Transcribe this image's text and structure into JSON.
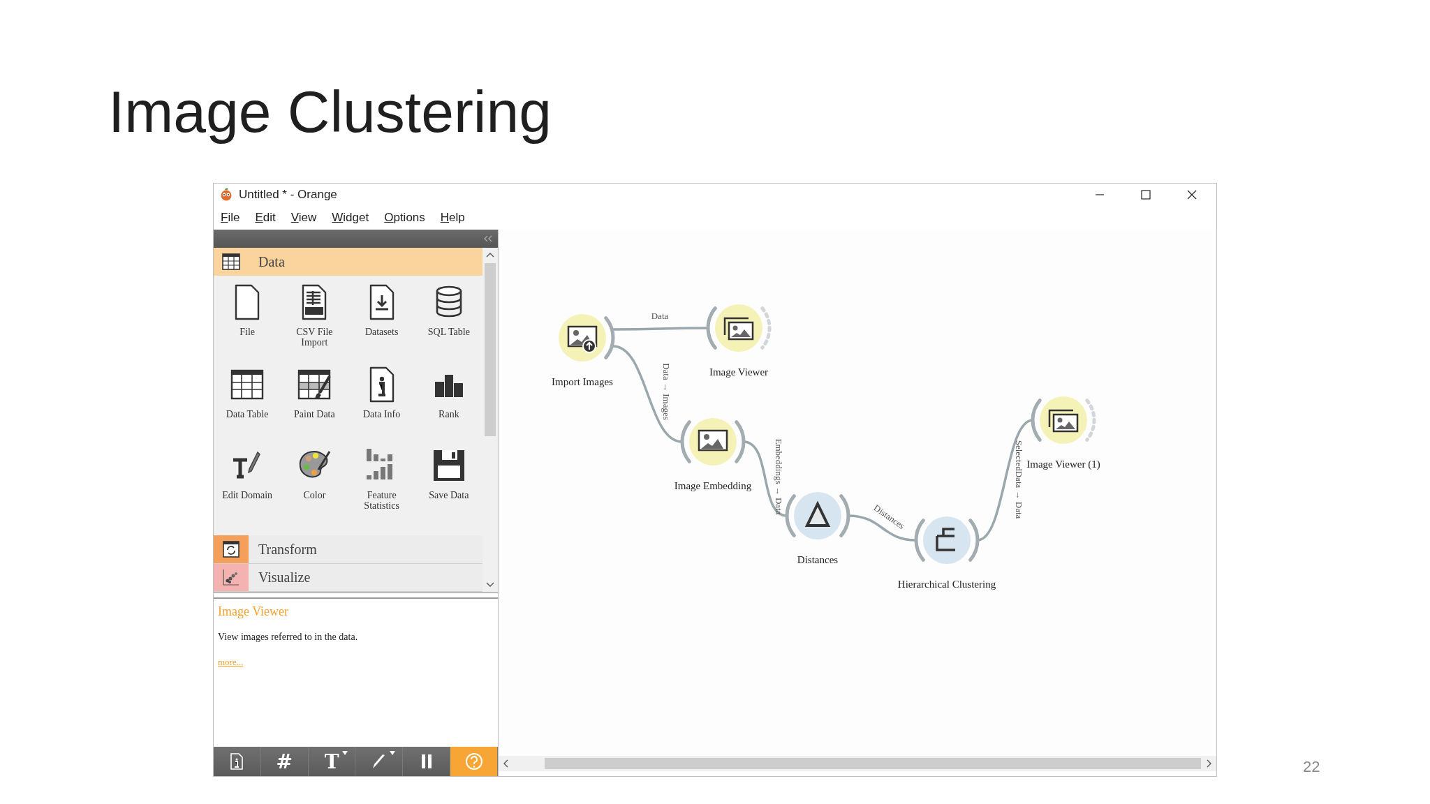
{
  "slide": {
    "title": "Image Clustering",
    "page_number": "22"
  },
  "window": {
    "title": "Untitled * - Orange"
  },
  "menu": [
    "File",
    "Edit",
    "View",
    "Widget",
    "Options",
    "Help"
  ],
  "categories": [
    {
      "label": "Data",
      "color": "#fbd39d",
      "expanded": true,
      "kind": "table",
      "widgets": [
        {
          "label": "File",
          "kind": "file"
        },
        {
          "label": "CSV File Import",
          "kind": "csv"
        },
        {
          "label": "Datasets",
          "kind": "datasets"
        },
        {
          "label": "SQL Table",
          "kind": "sql"
        },
        {
          "label": "Data Table",
          "kind": "table"
        },
        {
          "label": "Paint Data",
          "kind": "paint"
        },
        {
          "label": "Data Info",
          "kind": "info"
        },
        {
          "label": "Rank",
          "kind": "rank"
        },
        {
          "label": "Edit Domain",
          "kind": "edit"
        },
        {
          "label": "Color",
          "kind": "palette"
        },
        {
          "label": "Feature Statistics",
          "kind": "stats"
        },
        {
          "label": "Save Data",
          "kind": "save"
        }
      ]
    },
    {
      "label": "Transform",
      "color": "#f5a05a",
      "expanded": false,
      "kind": "transform"
    },
    {
      "label": "Visualize",
      "color": "#f4b3b0",
      "expanded": false,
      "kind": "scatter"
    }
  ],
  "description": {
    "title": "Image Viewer",
    "text": "View images referred to in the data.",
    "link": "more..."
  },
  "toolbar": [
    {
      "kind": "info",
      "on": false
    },
    {
      "kind": "glyph",
      "glyph": "#",
      "on": false
    },
    {
      "kind": "glyph",
      "glyph": "T",
      "on": false,
      "menu": true
    },
    {
      "kind": "pen",
      "on": false,
      "menu": true
    },
    {
      "kind": "pause",
      "on": false
    },
    {
      "kind": "help",
      "on": true
    }
  ],
  "nodes": [
    {
      "label": "Import Images",
      "kind": "import-images"
    },
    {
      "label": "Image Viewer",
      "kind": "image-viewer"
    },
    {
      "label": "Image Embedding",
      "kind": "image-embedding"
    },
    {
      "label": "Distances",
      "kind": "distances"
    },
    {
      "label": "Hierarchical Clustering",
      "kind": "clustering"
    },
    {
      "label": "Image Viewer (1)",
      "kind": "image-viewer"
    }
  ],
  "links": [
    {
      "label": "Data"
    },
    {
      "label": "Data → Images"
    },
    {
      "label": "Embeddings → Data"
    },
    {
      "label": "Distances"
    },
    {
      "label": "SelectedData → Data"
    }
  ]
}
